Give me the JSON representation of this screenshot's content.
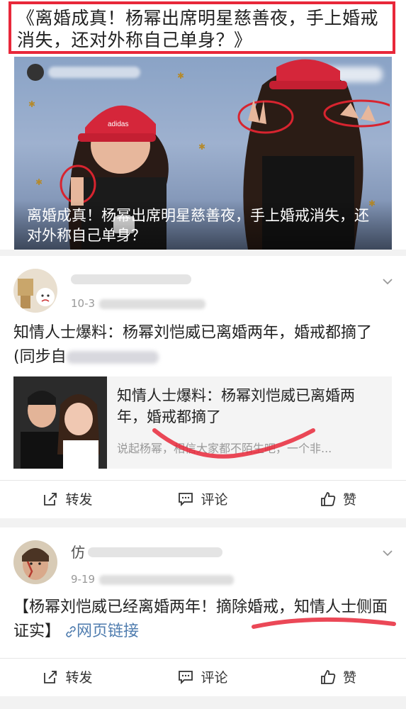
{
  "article": {
    "headline": "《离婚成真！杨幂出席明星慈善夜，手上婚戒消失，还对外称自己单身？》",
    "hero_caption": "离婚成真！杨幂出席明星慈善夜，手上婚戒消失，还对外称自己单身？"
  },
  "post1": {
    "date": "10-3",
    "text": "知情人士爆料：杨幂刘恺威已离婚两年，婚戒都摘了(同步自",
    "link_card": {
      "title": "知情人士爆料：杨幂刘恺威已离婚两年，婚戒都摘了",
      "summary": "说起杨幂，相信大家都不陌生吧，一个非..."
    },
    "actions": {
      "repost": "转发",
      "comment": "评论",
      "like": "赞"
    }
  },
  "post2": {
    "date": "9-19",
    "text_main": "【杨幂刘恺威已经离婚两年！摘除婚戒，知情人士侧面证实】",
    "link_label": "网页链接",
    "actions": {
      "repost": "转发",
      "comment": "评论",
      "like": "赞"
    }
  },
  "colors": {
    "highlight_red": "#e8283a",
    "link_blue": "#507daf"
  },
  "icons": [
    "repost-icon",
    "comment-icon",
    "like-icon",
    "chevron-down-icon",
    "link-icon"
  ]
}
